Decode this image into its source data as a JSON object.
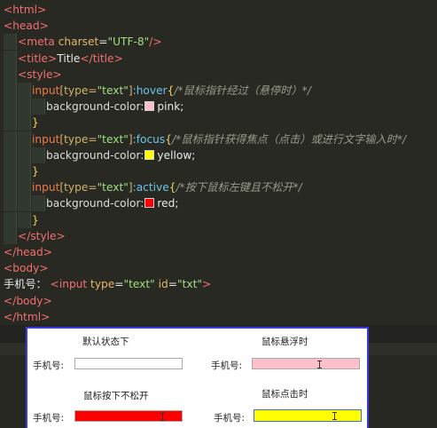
{
  "editor": {
    "lines": [
      {
        "parts": [
          {
            "c": "t-tag",
            "t": "<html>"
          }
        ]
      },
      {
        "parts": [
          {
            "c": "t-tag",
            "t": "<head>"
          }
        ]
      },
      {
        "parts": [
          {
            "c": "t-tag",
            "t": "<"
          },
          {
            "c": "t-tag",
            "t": "meta"
          },
          {
            "c": "t-attr",
            "t": " charset"
          },
          {
            "c": "t-val",
            "t": "="
          },
          {
            "c": "t-str",
            "t": "\"UTF-8\""
          },
          {
            "c": "t-tag",
            "t": "/>"
          }
        ]
      },
      {
        "parts": [
          {
            "c": "t-tag",
            "t": "<title>"
          },
          {
            "c": "t-val",
            "t": "Title"
          },
          {
            "c": "t-tag",
            "t": "</title>"
          }
        ]
      },
      {
        "parts": [
          {
            "c": "t-tag",
            "t": "<style>"
          }
        ]
      },
      {
        "parts": [
          {
            "c": "t-sel",
            "t": "input"
          },
          {
            "c": "t-sel2",
            "t": "[type="
          },
          {
            "c": "t-str",
            "t": "\"text\""
          },
          {
            "c": "t-sel2",
            "t": "]"
          },
          {
            "c": "t-pseudo",
            "t": ":hover"
          },
          {
            "c": "t-brace",
            "t": "{"
          },
          {
            "c": "t-cmt",
            "t": "/*鼠标指针经过（悬停时）*/"
          }
        ]
      },
      {
        "parts": [
          {
            "c": "t-prop",
            "t": "background-color:"
          },
          {
            "c": "swatch",
            "t": "#ffc0cb"
          },
          {
            "c": "t-val",
            "t": "pink;"
          }
        ]
      },
      {
        "parts": [
          {
            "c": "t-brace",
            "t": "}"
          }
        ]
      },
      {
        "parts": [
          {
            "c": "t-sel",
            "t": "input"
          },
          {
            "c": "t-sel2",
            "t": "[type="
          },
          {
            "c": "t-str",
            "t": "\"text\""
          },
          {
            "c": "t-sel2",
            "t": "]"
          },
          {
            "c": "t-pseudo",
            "t": ":focus"
          },
          {
            "c": "t-brace",
            "t": "{"
          },
          {
            "c": "t-cmt",
            "t": "/*鼠标指针获得焦点（点击）或进行文字输入时*/"
          }
        ]
      },
      {
        "parts": [
          {
            "c": "t-prop",
            "t": "background-color:"
          },
          {
            "c": "swatch",
            "t": "#ffff00"
          },
          {
            "c": "t-val",
            "t": "yellow;"
          }
        ]
      },
      {
        "parts": [
          {
            "c": "t-brace",
            "t": "}"
          }
        ]
      },
      {
        "parts": [
          {
            "c": "t-sel",
            "t": "input"
          },
          {
            "c": "t-sel2",
            "t": "[type="
          },
          {
            "c": "t-str",
            "t": "\"text\""
          },
          {
            "c": "t-sel2",
            "t": "]"
          },
          {
            "c": "t-pseudo",
            "t": ":active"
          },
          {
            "c": "t-brace",
            "t": "{"
          },
          {
            "c": "t-cmt",
            "t": "/*按下鼠标左键且不松开*/"
          }
        ]
      },
      {
        "parts": [
          {
            "c": "t-prop",
            "t": "background-color:"
          },
          {
            "c": "swatch",
            "t": "#ff0000"
          },
          {
            "c": "t-val",
            "t": "red;"
          }
        ]
      },
      {
        "parts": [
          {
            "c": "t-brace",
            "t": "}"
          }
        ]
      },
      {
        "parts": [
          {
            "c": "t-tag",
            "t": "</style>"
          }
        ]
      },
      {
        "parts": [
          {
            "c": "t-tag",
            "t": "</head>"
          }
        ]
      },
      {
        "parts": [
          {
            "c": "t-tag",
            "t": "<body>"
          }
        ]
      },
      {
        "parts": [
          {
            "c": "t-val",
            "t": "手机号：  "
          },
          {
            "c": "t-tag",
            "t": "<input"
          },
          {
            "c": "t-attr",
            "t": " type"
          },
          {
            "c": "t-val",
            "t": "="
          },
          {
            "c": "t-str",
            "t": "\"text\""
          },
          {
            "c": "t-attr",
            "t": " id"
          },
          {
            "c": "t-val",
            "t": "="
          },
          {
            "c": "t-str",
            "t": "\"txt\""
          },
          {
            "c": "t-tag",
            "t": ">"
          }
        ]
      },
      {
        "parts": [
          {
            "c": "t-tag",
            "t": "</body>"
          }
        ]
      },
      {
        "parts": [
          {
            "c": "t-tag",
            "t": "</html>"
          }
        ]
      }
    ]
  },
  "preview": {
    "states": [
      {
        "caption": "默认状态下",
        "label": "手机号:",
        "fill": "#ffffff",
        "border": "#a9a9a9",
        "cursor": false
      },
      {
        "caption": "鼠标悬浮时",
        "label": "手机号:",
        "fill": "#ffc0cb",
        "border": "#a9a9a9",
        "cursor": true
      },
      {
        "caption": "鼠标按下不松开",
        "label": "手机号:",
        "fill": "#ff0000",
        "border": "#a9a9a9",
        "cursor": true
      },
      {
        "caption": "鼠标点击时",
        "label": "手机号:",
        "fill": "#ffff00",
        "border": "#3b6fd6",
        "cursor": true
      }
    ]
  }
}
